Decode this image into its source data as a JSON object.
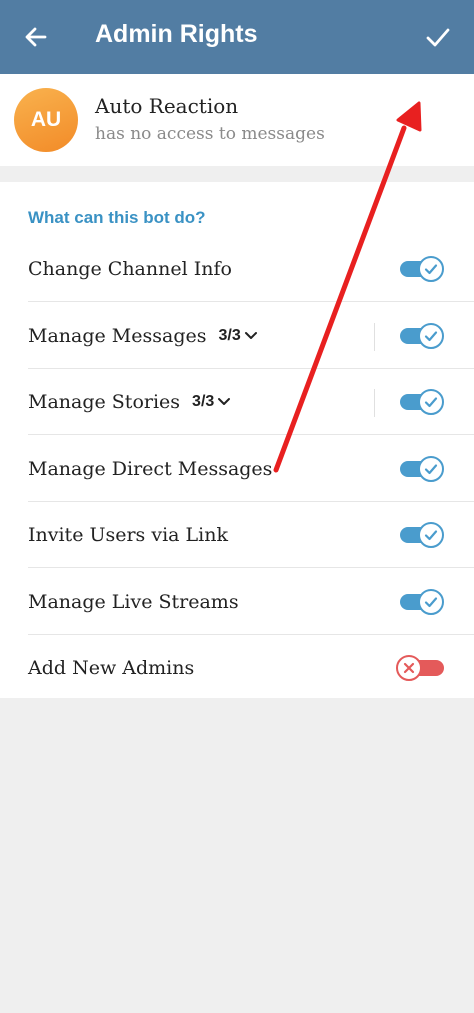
{
  "header": {
    "title": "Admin Rights",
    "back_icon": "arrow-left-icon",
    "done_icon": "check-icon"
  },
  "bot": {
    "initials": "AU",
    "name": "Auto Reaction",
    "status": "has no access to messages"
  },
  "section": {
    "title": "What can this bot do?"
  },
  "permissions": [
    {
      "label": "Change Channel Info",
      "count": "",
      "enabled": true
    },
    {
      "label": "Manage Messages",
      "count": "3/3",
      "enabled": true
    },
    {
      "label": "Manage Stories",
      "count": "3/3",
      "enabled": true
    },
    {
      "label": "Manage Direct Messages",
      "count": "",
      "enabled": true
    },
    {
      "label": "Invite Users via Link",
      "count": "",
      "enabled": true
    },
    {
      "label": "Manage Live Streams",
      "count": "",
      "enabled": true
    },
    {
      "label": "Add New Admins",
      "count": "",
      "enabled": false
    }
  ],
  "colors": {
    "header": "#527da3",
    "accent": "#3a92c4",
    "toggle_on": "#4a9ccd",
    "toggle_off": "#e45a5a",
    "annotation_arrow": "#e82020"
  }
}
